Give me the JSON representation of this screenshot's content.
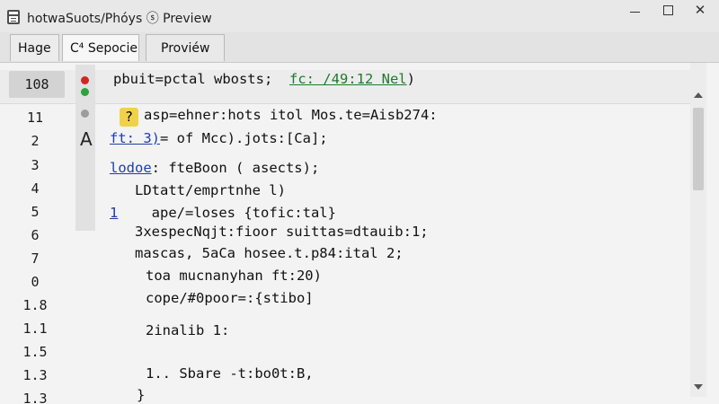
{
  "window": {
    "title": "hotwaSuots/Phóys ⓢ Preview",
    "icon": "document-window-icon",
    "controls": {
      "minimize": "minimize-icon",
      "maximize": "maximize-icon",
      "close": "✕"
    }
  },
  "tabs": [
    {
      "label": "Hage"
    },
    {
      "label": "C⁴ Sepocie"
    },
    {
      "label": "Proviéw"
    }
  ],
  "editor": {
    "current_line_number": "108",
    "current_line": {
      "code": "pbuit=pctal wbosts;",
      "comment": "fc: /49:12 Nel"
    },
    "line_numbers": [
      "11",
      "2",
      "3",
      "4",
      "5",
      "6",
      "7",
      "0",
      "1.8",
      "1.1",
      "1.5",
      "1.3",
      "1.3"
    ],
    "lines": [
      {
        "marker": "?",
        "text": "asp=ehner:hots itol Mos.te=Aisb274:"
      },
      {
        "prefix": "ft: 3)",
        "text": "= of Mcc).jots:[Ca];"
      },
      {
        "prefix": "lodoe",
        "text": ": fteBoon ( asects);"
      },
      {
        "text": "LDtatt/emprtnhe l)"
      },
      {
        "prefix": "1",
        "text": "ape/=loses {tofic:tal}"
      },
      {
        "text": "3xespecNqjt:fioor suittas=dtauib:1;"
      },
      {
        "text": "mascas, 5aCa hosee.t.p84:ital 2;"
      },
      {
        "text": "toa mucnanyhan ft:20)"
      },
      {
        "text": "cope/#0poor=:{stibo]"
      },
      {
        "text": "2inalib 1:"
      },
      {
        "text": "1.. Sbare -t:bo0t:B,"
      },
      {
        "text": "}"
      }
    ],
    "gutter_glyph": "A",
    "status_dots": {
      "error": "#d42525",
      "ok": "#2aa33a",
      "idle": "#9c9c9c"
    }
  },
  "scrollbar": {
    "up": "scroll-up-icon",
    "down": "scroll-down-icon"
  }
}
